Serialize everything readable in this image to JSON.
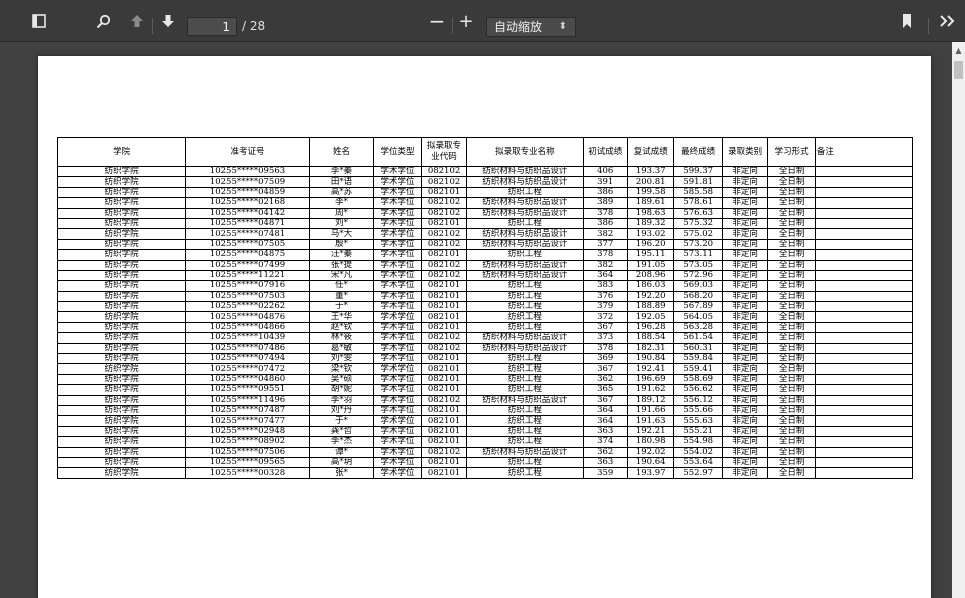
{
  "toolbar": {
    "sidebar_toggle_icon": "sidebar-icon",
    "search_icon": "search-icon",
    "prev_icon": "arrow-up-icon",
    "next_icon": "arrow-down-icon",
    "page_number": "1",
    "page_count": "/ 28",
    "zoom_out_label": "−",
    "zoom_in_label": "+",
    "zoom_value": "自动缩放",
    "bookmark_icon": "bookmark-icon",
    "more_icon": "double-chevron-right-icon"
  },
  "table": {
    "headers": [
      "学院",
      "准考证号",
      "姓名",
      "学位类型",
      "拟录取专业代码",
      "拟录取专业名称",
      "初试成绩",
      "复试成绩",
      "最终成绩",
      "录取类别",
      "学习形式",
      "备注"
    ],
    "rows": [
      [
        "纺织学院",
        "10255*****09563",
        "李*蓁",
        "学术学位",
        "082102",
        "纺织材料与纺织品设计",
        "406",
        "193.37",
        "599.37",
        "非定向",
        "全日制",
        ""
      ],
      [
        "纺织学院",
        "10255*****07509",
        "田*语",
        "学术学位",
        "082102",
        "纺织材料与纺织品设计",
        "391",
        "200.81",
        "591.81",
        "非定向",
        "全日制",
        ""
      ],
      [
        "纺织学院",
        "10255*****04859",
        "高*苏",
        "学术学位",
        "082101",
        "纺织工程",
        "386",
        "199.58",
        "585.58",
        "非定向",
        "全日制",
        ""
      ],
      [
        "纺织学院",
        "10255*****02168",
        "李*",
        "学术学位",
        "082102",
        "纺织材料与纺织品设计",
        "389",
        "189.61",
        "578.61",
        "非定向",
        "全日制",
        ""
      ],
      [
        "纺织学院",
        "10255*****04142",
        "周*",
        "学术学位",
        "082102",
        "纺织材料与纺织品设计",
        "378",
        "198.63",
        "576.63",
        "非定向",
        "全日制",
        ""
      ],
      [
        "纺织学院",
        "10255*****04871",
        "刘*",
        "学术学位",
        "082101",
        "纺织工程",
        "386",
        "189.32",
        "575.32",
        "非定向",
        "全日制",
        ""
      ],
      [
        "纺织学院",
        "10255*****07481",
        "马*大",
        "学术学位",
        "082102",
        "纺织材料与纺织品设计",
        "382",
        "193.02",
        "575.02",
        "非定向",
        "全日制",
        ""
      ],
      [
        "纺织学院",
        "10255*****07505",
        "殷*",
        "学术学位",
        "082102",
        "纺织材料与纺织品设计",
        "377",
        "196.20",
        "573.20",
        "非定向",
        "全日制",
        ""
      ],
      [
        "纺织学院",
        "10255*****04875",
        "汪*蓁",
        "学术学位",
        "082101",
        "纺织工程",
        "378",
        "195.11",
        "573.11",
        "非定向",
        "全日制",
        ""
      ],
      [
        "纺织学院",
        "10255*****07499",
        "张*提",
        "学术学位",
        "082102",
        "纺织材料与纺织品设计",
        "382",
        "191.05",
        "573.05",
        "非定向",
        "全日制",
        ""
      ],
      [
        "纺织学院",
        "10255*****11221",
        "宋*凡",
        "学术学位",
        "082102",
        "纺织材料与纺织品设计",
        "364",
        "208.96",
        "572.96",
        "非定向",
        "全日制",
        ""
      ],
      [
        "纺织学院",
        "10255*****07916",
        "任*",
        "学术学位",
        "082101",
        "纺织工程",
        "383",
        "186.03",
        "569.03",
        "非定向",
        "全日制",
        ""
      ],
      [
        "纺织学院",
        "10255*****07503",
        "董*",
        "学术学位",
        "082101",
        "纺织工程",
        "376",
        "192.20",
        "568.20",
        "非定向",
        "全日制",
        ""
      ],
      [
        "纺织学院",
        "10255*****02262",
        "于*",
        "学术学位",
        "082101",
        "纺织工程",
        "379",
        "188.89",
        "567.89",
        "非定向",
        "全日制",
        ""
      ],
      [
        "纺织学院",
        "10255*****04876",
        "王*华",
        "学术学位",
        "082101",
        "纺织工程",
        "372",
        "192.05",
        "564.05",
        "非定向",
        "全日制",
        ""
      ],
      [
        "纺织学院",
        "10255*****04866",
        "赵*钦",
        "学术学位",
        "082101",
        "纺织工程",
        "367",
        "196.28",
        "563.28",
        "非定向",
        "全日制",
        ""
      ],
      [
        "纺织学院",
        "10255*****10439",
        "林*筱",
        "学术学位",
        "082102",
        "纺织材料与纺织品设计",
        "373",
        "188.54",
        "561.54",
        "非定向",
        "全日制",
        ""
      ],
      [
        "纺织学院",
        "10255*****07486",
        "葛*敏",
        "学术学位",
        "082102",
        "纺织材料与纺织品设计",
        "378",
        "182.31",
        "560.31",
        "非定向",
        "全日制",
        ""
      ],
      [
        "纺织学院",
        "10255*****07494",
        "刘*雯",
        "学术学位",
        "082101",
        "纺织工程",
        "369",
        "190.84",
        "559.84",
        "非定向",
        "全日制",
        ""
      ],
      [
        "纺织学院",
        "10255*****07472",
        "梁*钦",
        "学术学位",
        "082101",
        "纺织工程",
        "367",
        "192.41",
        "559.41",
        "非定向",
        "全日制",
        ""
      ],
      [
        "纺织学院",
        "10255*****04860",
        "吴*硕",
        "学术学位",
        "082101",
        "纺织工程",
        "362",
        "196.69",
        "558.69",
        "非定向",
        "全日制",
        ""
      ],
      [
        "纺织学院",
        "10255*****09551",
        "胡*妮",
        "学术学位",
        "082101",
        "纺织工程",
        "365",
        "191.62",
        "556.62",
        "非定向",
        "全日制",
        ""
      ],
      [
        "纺织学院",
        "10255*****11496",
        "李*羽",
        "学术学位",
        "082102",
        "纺织材料与纺织品设计",
        "367",
        "189.12",
        "556.12",
        "非定向",
        "全日制",
        ""
      ],
      [
        "纺织学院",
        "10255*****07487",
        "刘*丹",
        "学术学位",
        "082101",
        "纺织工程",
        "364",
        "191.66",
        "555.66",
        "非定向",
        "全日制",
        ""
      ],
      [
        "纺织学院",
        "10255*****07477",
        "于*",
        "学术学位",
        "082101",
        "纺织工程",
        "364",
        "191.63",
        "555.63",
        "非定向",
        "全日制",
        ""
      ],
      [
        "纺织学院",
        "10255*****02948",
        "龚*哲",
        "学术学位",
        "082101",
        "纺织工程",
        "363",
        "192.21",
        "555.21",
        "非定向",
        "全日制",
        ""
      ],
      [
        "纺织学院",
        "10255*****08902",
        "李*杰",
        "学术学位",
        "082101",
        "纺织工程",
        "374",
        "180.98",
        "554.98",
        "非定向",
        "全日制",
        ""
      ],
      [
        "纺织学院",
        "10255*****07506",
        "谭*",
        "学术学位",
        "082102",
        "纺织材料与纺织品设计",
        "362",
        "192.02",
        "554.02",
        "非定向",
        "全日制",
        ""
      ],
      [
        "纺织学院",
        "10255*****09565",
        "高*玥",
        "学术学位",
        "082101",
        "纺织工程",
        "363",
        "190.64",
        "553.64",
        "非定向",
        "全日制",
        ""
      ],
      [
        "纺织学院",
        "10255*****00328",
        "张*",
        "学术学位",
        "082101",
        "纺织工程",
        "359",
        "193.97",
        "552.97",
        "非定向",
        "全日制",
        ""
      ]
    ]
  }
}
